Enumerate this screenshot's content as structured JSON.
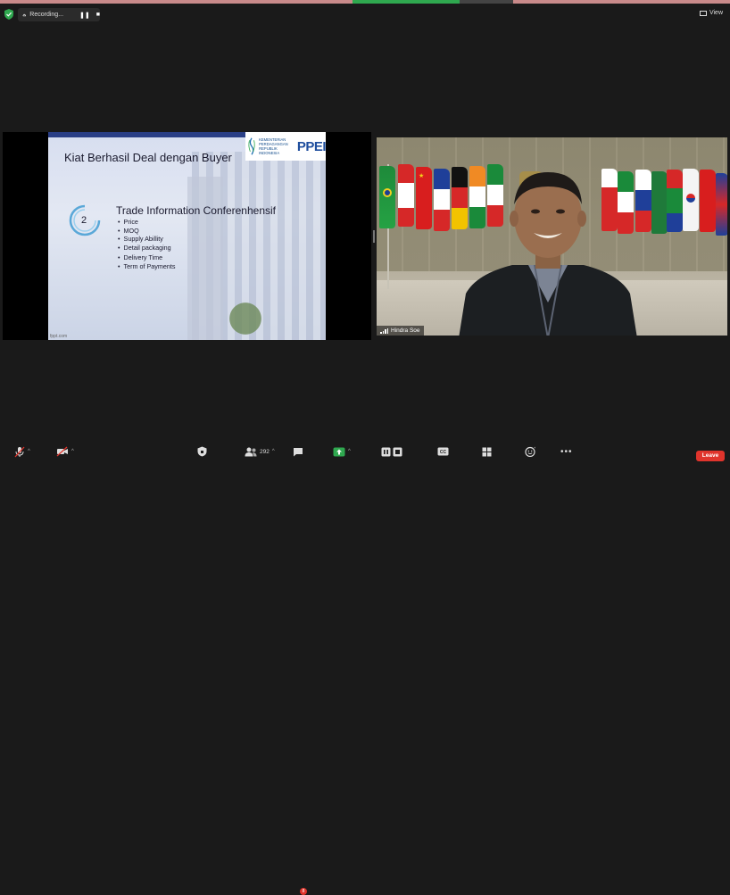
{
  "top_bar": {
    "recording_label": "Recording...",
    "view_label": "View"
  },
  "shared_slide": {
    "title": "Kiat Berhasil Deal dengan Buyer",
    "logo_text": [
      "KEMENTERIAN",
      "PERDAGANGAN",
      "REPUBLIK INDONESIA"
    ],
    "logo_acronym": "PPEI",
    "number": "2",
    "subtitle": "Trade Information Conferenhensif",
    "bullets": [
      "Price",
      "MOQ",
      "Supply Abillity",
      "Detail packaging",
      "Delivery Time",
      "Term of Payments"
    ],
    "footer": "fppt.com"
  },
  "participant": {
    "name": "Hindra Soe"
  },
  "toolbar": {
    "participants_count": "292",
    "chat_badge": "8",
    "leave_label": "Leave"
  },
  "colors": {
    "accent_green": "#2fa84f",
    "leave_red": "#e0342c",
    "background": "#1a1a1a"
  }
}
